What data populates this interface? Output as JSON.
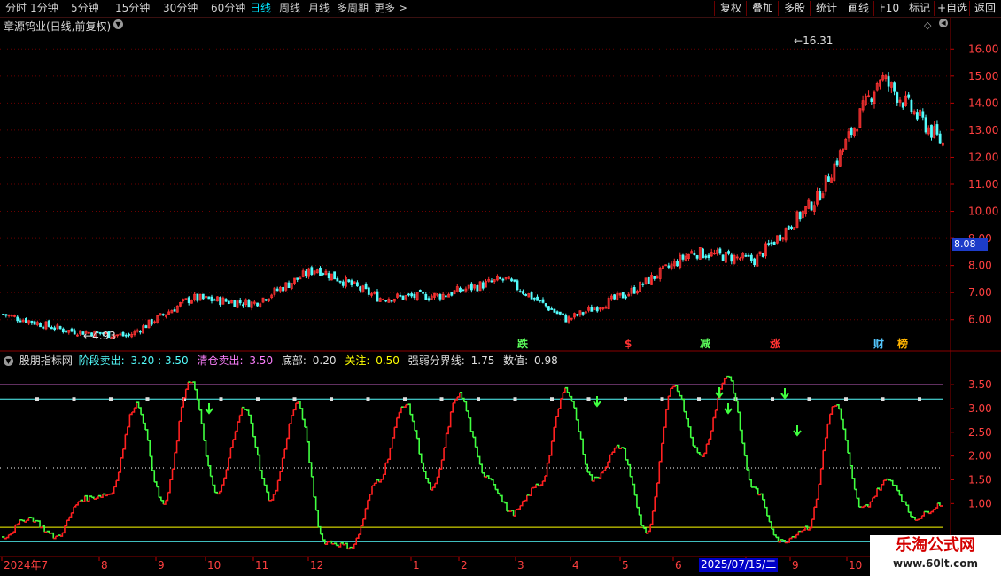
{
  "toolbar": {
    "periods": [
      "分时",
      "1分钟",
      "5分钟",
      "15分钟",
      "30分钟",
      "60分钟",
      "日线",
      "周线",
      "月线",
      "多周期",
      "更多 >"
    ],
    "active_period": "日线",
    "right_buttons": [
      "复权",
      "叠加",
      "多股",
      "统计",
      "画线",
      "F10",
      "标记",
      "+自选",
      "返回"
    ]
  },
  "main_chart": {
    "title": "章源钨业(日线,前复权)",
    "price_axis": [
      "16.00",
      "15.00",
      "14.00",
      "13.00",
      "12.00",
      "11.00",
      "10.00",
      "9.00",
      "8.00",
      "7.00",
      "6.00"
    ],
    "current_price": "8.08",
    "high_label": "16.31",
    "low_label": "4.93",
    "events": [
      "跌",
      "$",
      "减",
      "涨",
      "财",
      "榜"
    ],
    "colors": {
      "up": "#ff3232",
      "down": "#54fcfc",
      "grid": "#7a0000"
    }
  },
  "indicator": {
    "name": "股朋指标网",
    "params": [
      {
        "label": "阶段卖出:",
        "value": "3.20 : 3.50",
        "color": "#54fcfc"
      },
      {
        "label": "清仓卖出:",
        "value": "3.50",
        "color": "#ff80ff"
      },
      {
        "label": "底部:",
        "value": "0.20",
        "color": "#e0e0e0"
      },
      {
        "label": "关注:",
        "value": "0.50",
        "color": "#ffff00"
      },
      {
        "label": "强弱分界线:",
        "value": "1.75",
        "color": "#e0e0e0"
      },
      {
        "label": "数值:",
        "value": "0.98",
        "color": "#e0e0e0"
      }
    ],
    "axis": [
      "3.50",
      "3.00",
      "2.50",
      "2.00",
      "1.50",
      "1.00"
    ]
  },
  "time_axis": {
    "labels": [
      "2024年7",
      "8",
      "9",
      "10",
      "11",
      "12",
      "1",
      "2",
      "3",
      "4",
      "5",
      "6",
      "7",
      "9",
      "10"
    ],
    "cursor_date": "2025/07/15/二"
  },
  "watermark": {
    "line1": "乐淘公式网",
    "line2": "www.60lt.com"
  },
  "chart_data": {
    "type": "line",
    "title": "章源钨业(日线,前复权)",
    "xlabel": "",
    "ylabel": "",
    "x": [
      "2024-07",
      "2024-08",
      "2024-09",
      "2024-10",
      "2024-11",
      "2024-12",
      "2025-01",
      "2025-02",
      "2025-03",
      "2025-04",
      "2025-05",
      "2025-06",
      "2025-07",
      "2025-08",
      "2025-09",
      "2025-10"
    ],
    "ylim": [
      5.5,
      16.5
    ],
    "series": [
      {
        "values": [
          6.2,
          5.6,
          5.4,
          6.8,
          6.6,
          7.9,
          6.8,
          6.9,
          7.5,
          6.0,
          7.0,
          8.5,
          8.2,
          10.5,
          15.0,
          12.5
        ]
      }
    ],
    "indicator_ylim": [
      0,
      3.8
    ],
    "indicator_levels": {
      "stage_sell_lower": 3.2,
      "stage_sell_upper": 3.5,
      "clear_sell": 3.5,
      "bottom": 0.2,
      "attention": 0.5,
      "strong_weak_line": 1.75,
      "current_value": 0.98
    },
    "indicator_values": [
      0.3,
      0.7,
      0.3,
      1.1,
      1.2,
      3.1,
      1.0,
      3.6,
      1.2,
      3.0,
      1.1,
      3.1,
      0.2,
      0.1,
      1.5,
      3.1,
      1.3,
      3.3,
      1.6,
      0.8,
      1.4,
      3.4,
      1.5,
      2.2,
      0.4,
      3.5,
      2.0,
      3.7,
      1.3,
      0.2,
      0.5,
      3.1,
      0.9,
      1.5,
      0.7,
      1.0
    ]
  }
}
